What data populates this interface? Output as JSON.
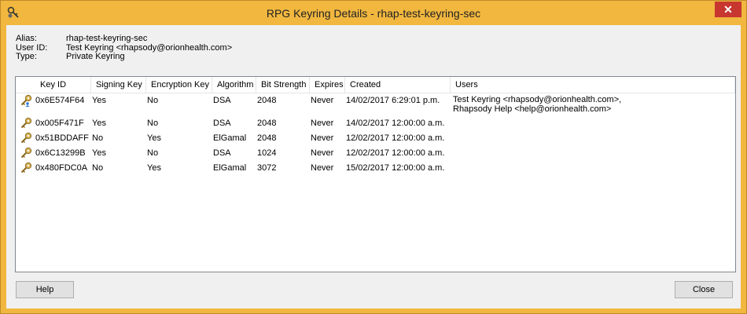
{
  "window": {
    "title": "RPG Keyring Details - rhap-test-keyring-sec",
    "close_glyph": "✕",
    "accent_color": "#f1b73f",
    "close_color": "#c7372f"
  },
  "info": {
    "alias_label": "Alias:",
    "alias_value": "rhap-test-keyring-sec",
    "userid_label": "User ID:",
    "userid_value": "Test Keyring <rhapsody@orionhealth.com>",
    "type_label": "Type:",
    "type_value": "Private Keyring"
  },
  "table": {
    "columns": [
      "Key ID",
      "Signing Key",
      "Encryption Key",
      "Algorithm",
      "Bit Strength",
      "Expires",
      "Created",
      "Users"
    ],
    "rows": [
      {
        "icon": "key-user-icon",
        "key_id": "0x6E574F64",
        "signing": "Yes",
        "encryption": "No",
        "algorithm": "DSA",
        "bits": "2048",
        "expires": "Never",
        "created": "14/02/2017 6:29:01 p.m.",
        "users_line1": "Test Keyring <rhapsody@orionhealth.com>,",
        "users_line2": "Rhapsody Help <help@orionhealth.com>"
      },
      {
        "icon": "key-icon",
        "key_id": "0x005F471F",
        "signing": "Yes",
        "encryption": "No",
        "algorithm": "DSA",
        "bits": "2048",
        "expires": "Never",
        "created": "14/02/2017 12:00:00 a.m.",
        "users_line1": "",
        "users_line2": ""
      },
      {
        "icon": "key-icon",
        "key_id": "0x51BDDAFF",
        "signing": "No",
        "encryption": "Yes",
        "algorithm": "ElGamal",
        "bits": "2048",
        "expires": "Never",
        "created": "12/02/2017 12:00:00 a.m.",
        "users_line1": "",
        "users_line2": ""
      },
      {
        "icon": "key-icon",
        "key_id": "0x6C13299B",
        "signing": "Yes",
        "encryption": "No",
        "algorithm": "DSA",
        "bits": "1024",
        "expires": "Never",
        "created": "12/02/2017 12:00:00 a.m.",
        "users_line1": "",
        "users_line2": ""
      },
      {
        "icon": "key-icon",
        "key_id": "0x480FDC0A",
        "signing": "No",
        "encryption": "Yes",
        "algorithm": "ElGamal",
        "bits": "3072",
        "expires": "Never",
        "created": "15/02/2017 12:00:00 a.m.",
        "users_line1": "",
        "users_line2": ""
      }
    ]
  },
  "buttons": {
    "help_label": "Help",
    "close_label": "Close"
  }
}
